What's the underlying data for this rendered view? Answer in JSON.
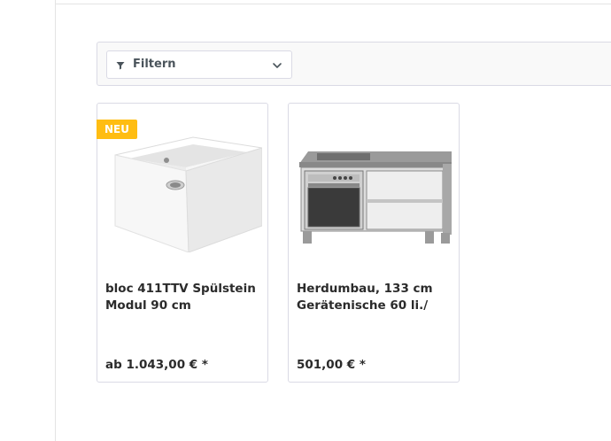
{
  "filter": {
    "label": "Filtern",
    "icon": "filter-icon",
    "chevron_icon": "chevron-down-icon"
  },
  "products": [
    {
      "badge": "NEU",
      "name": "bloc 411TTV Spülstein Modul 90 cm",
      "price": "ab 1.043,00 € *",
      "image": "white-ceramic-sink-image"
    },
    {
      "badge": "",
      "name": "Herdumbau, 133 cm Gerätenische 60 li./",
      "price": "501,00 € *",
      "image": "kitchen-stove-cabinet-image"
    }
  ],
  "colors": {
    "badge": "#ffbd12",
    "border": "#dadae5",
    "panel_bg": "#f9f9f9",
    "text": "#2b2b2b"
  }
}
